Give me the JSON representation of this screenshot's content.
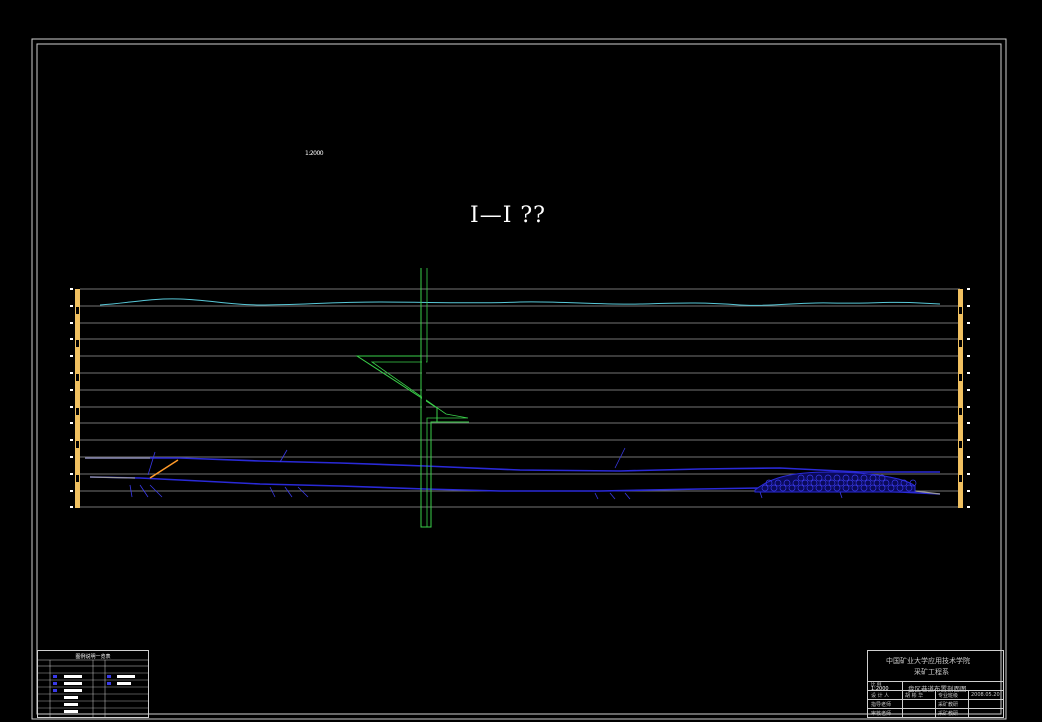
{
  "drawing": {
    "section_title": "I—I ??",
    "scale_note": "1:2000",
    "legend_title": "图例说明一览表"
  },
  "title_block": {
    "institution": "中国矿业大学应用技术学院",
    "department": "采矿工程系",
    "drawing_name": "盘区巷道布置剖面图",
    "scale": "1:2000",
    "date": "2008.05.20",
    "row_labels": [
      "比 例",
      "设 计 人",
      "指导老师",
      "审核老师"
    ],
    "row_values": [
      "",
      "胡 彬 华",
      "",
      ""
    ],
    "right_labels": [
      "",
      "专业班级",
      "采矿教研",
      "采矿教研"
    ]
  },
  "colors": {
    "frame": "#cfcfcf",
    "grid": "#e6e6e6",
    "surface": "#58c8d8",
    "seam": "#2a2ad8",
    "fault": "#3ad04a",
    "ruler": "#f0c060",
    "drift": "#ff9a2a"
  }
}
